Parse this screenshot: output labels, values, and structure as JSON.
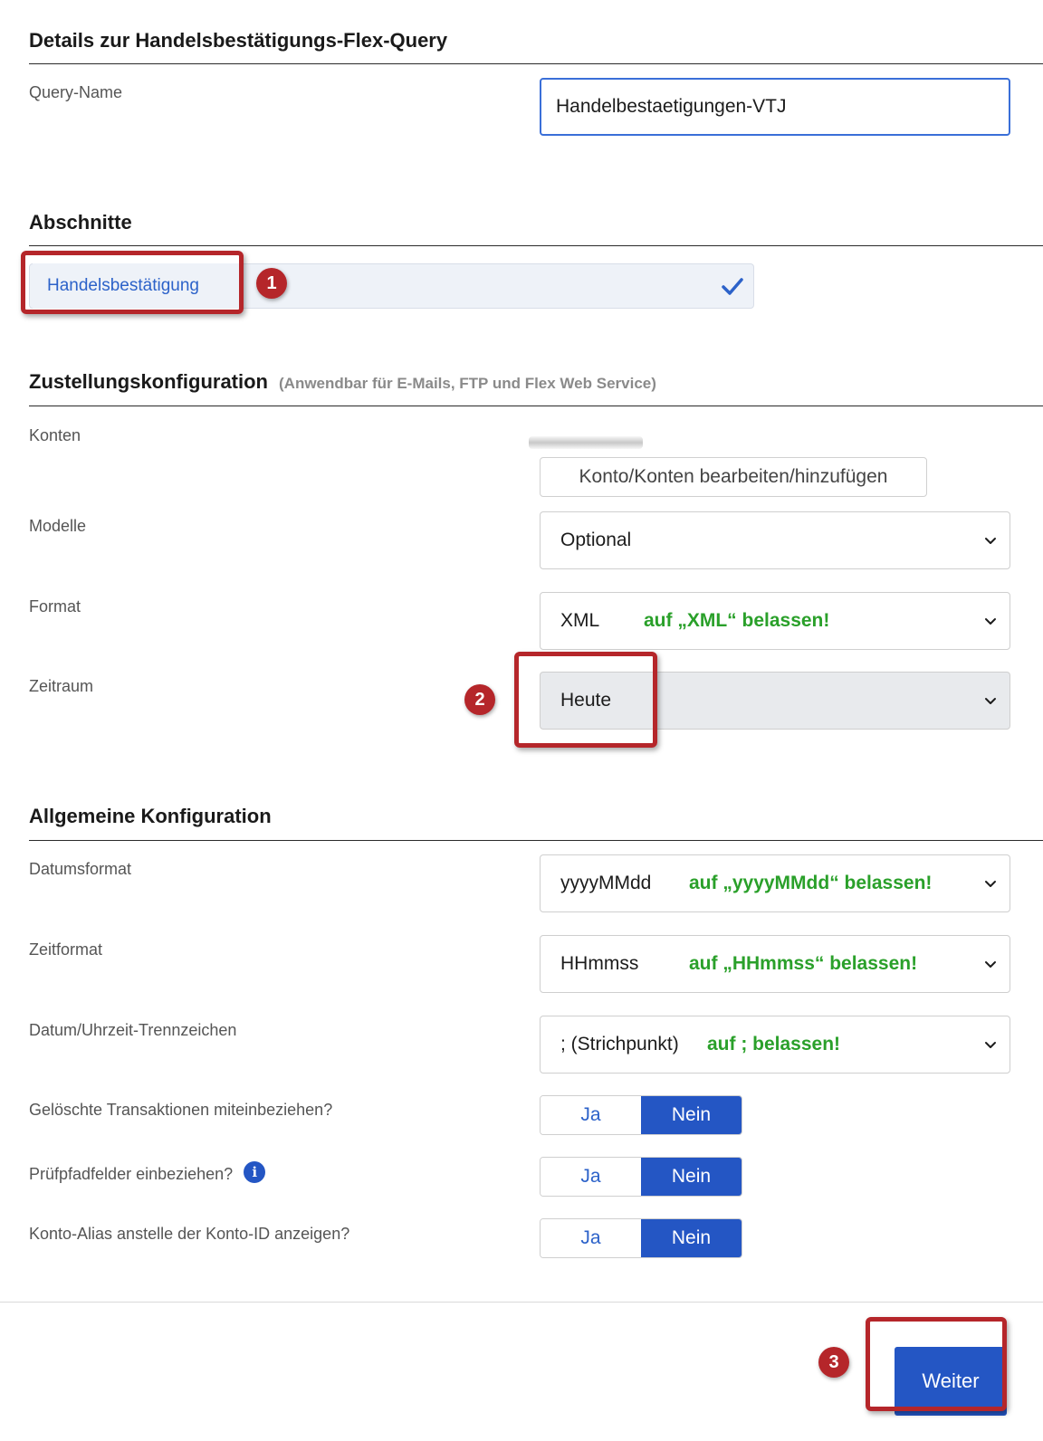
{
  "details": {
    "title": "Details zur Handelsbestätigungs-Flex-Query",
    "query_name_label": "Query-Name",
    "query_name_value": "Handelbestaetigungen-VTJ"
  },
  "sections": {
    "title": "Abschnitte",
    "item_label": "Handelsbestätigung",
    "marker": "1"
  },
  "delivery": {
    "title": "Zustellungskonfiguration",
    "subtitle": "(Anwendbar für E-Mails, FTP und Flex Web Service)",
    "accounts_label": "Konten",
    "accounts_button": "Konto/Konten bearbeiten/hinzufügen",
    "models_label": "Modelle",
    "models_value": "Optional",
    "format_label": "Format",
    "format_value": "XML",
    "format_hint": "auf „XML“ belassen!",
    "period_label": "Zeitraum",
    "period_value": "Heute",
    "period_marker": "2"
  },
  "general": {
    "title": "Allgemeine Konfiguration",
    "date_format_label": "Datumsformat",
    "date_format_value": "yyyyMMdd",
    "date_format_hint": "auf „yyyyMMdd“ belassen!",
    "time_format_label": "Zeitformat",
    "time_format_value": "HHmmss",
    "time_format_hint": "auf „HHmmss“ belassen!",
    "separator_label": "Datum/Uhrzeit-Trennzeichen",
    "separator_value": "; (Strichpunkt)",
    "separator_hint": "auf ; belassen!",
    "toggles": [
      {
        "label": "Gelöschte Transaktionen miteinbeziehen?",
        "yes": "Ja",
        "no": "Nein",
        "selected": "Nein"
      },
      {
        "label": "Prüfpfadfelder einbeziehen?",
        "yes": "Ja",
        "no": "Nein",
        "selected": "Nein"
      },
      {
        "label": "Konto-Alias anstelle der Konto-ID anzeigen?",
        "yes": "Ja",
        "no": "Nein",
        "selected": "Nein"
      }
    ],
    "info_icon_glyph": "i"
  },
  "footer": {
    "next_button": "Weiter",
    "next_marker": "3"
  },
  "colors": {
    "accent": "#2456c4",
    "link": "#2c62c9",
    "hint_green": "#2aa02a",
    "annotation_red": "#b5262a"
  }
}
